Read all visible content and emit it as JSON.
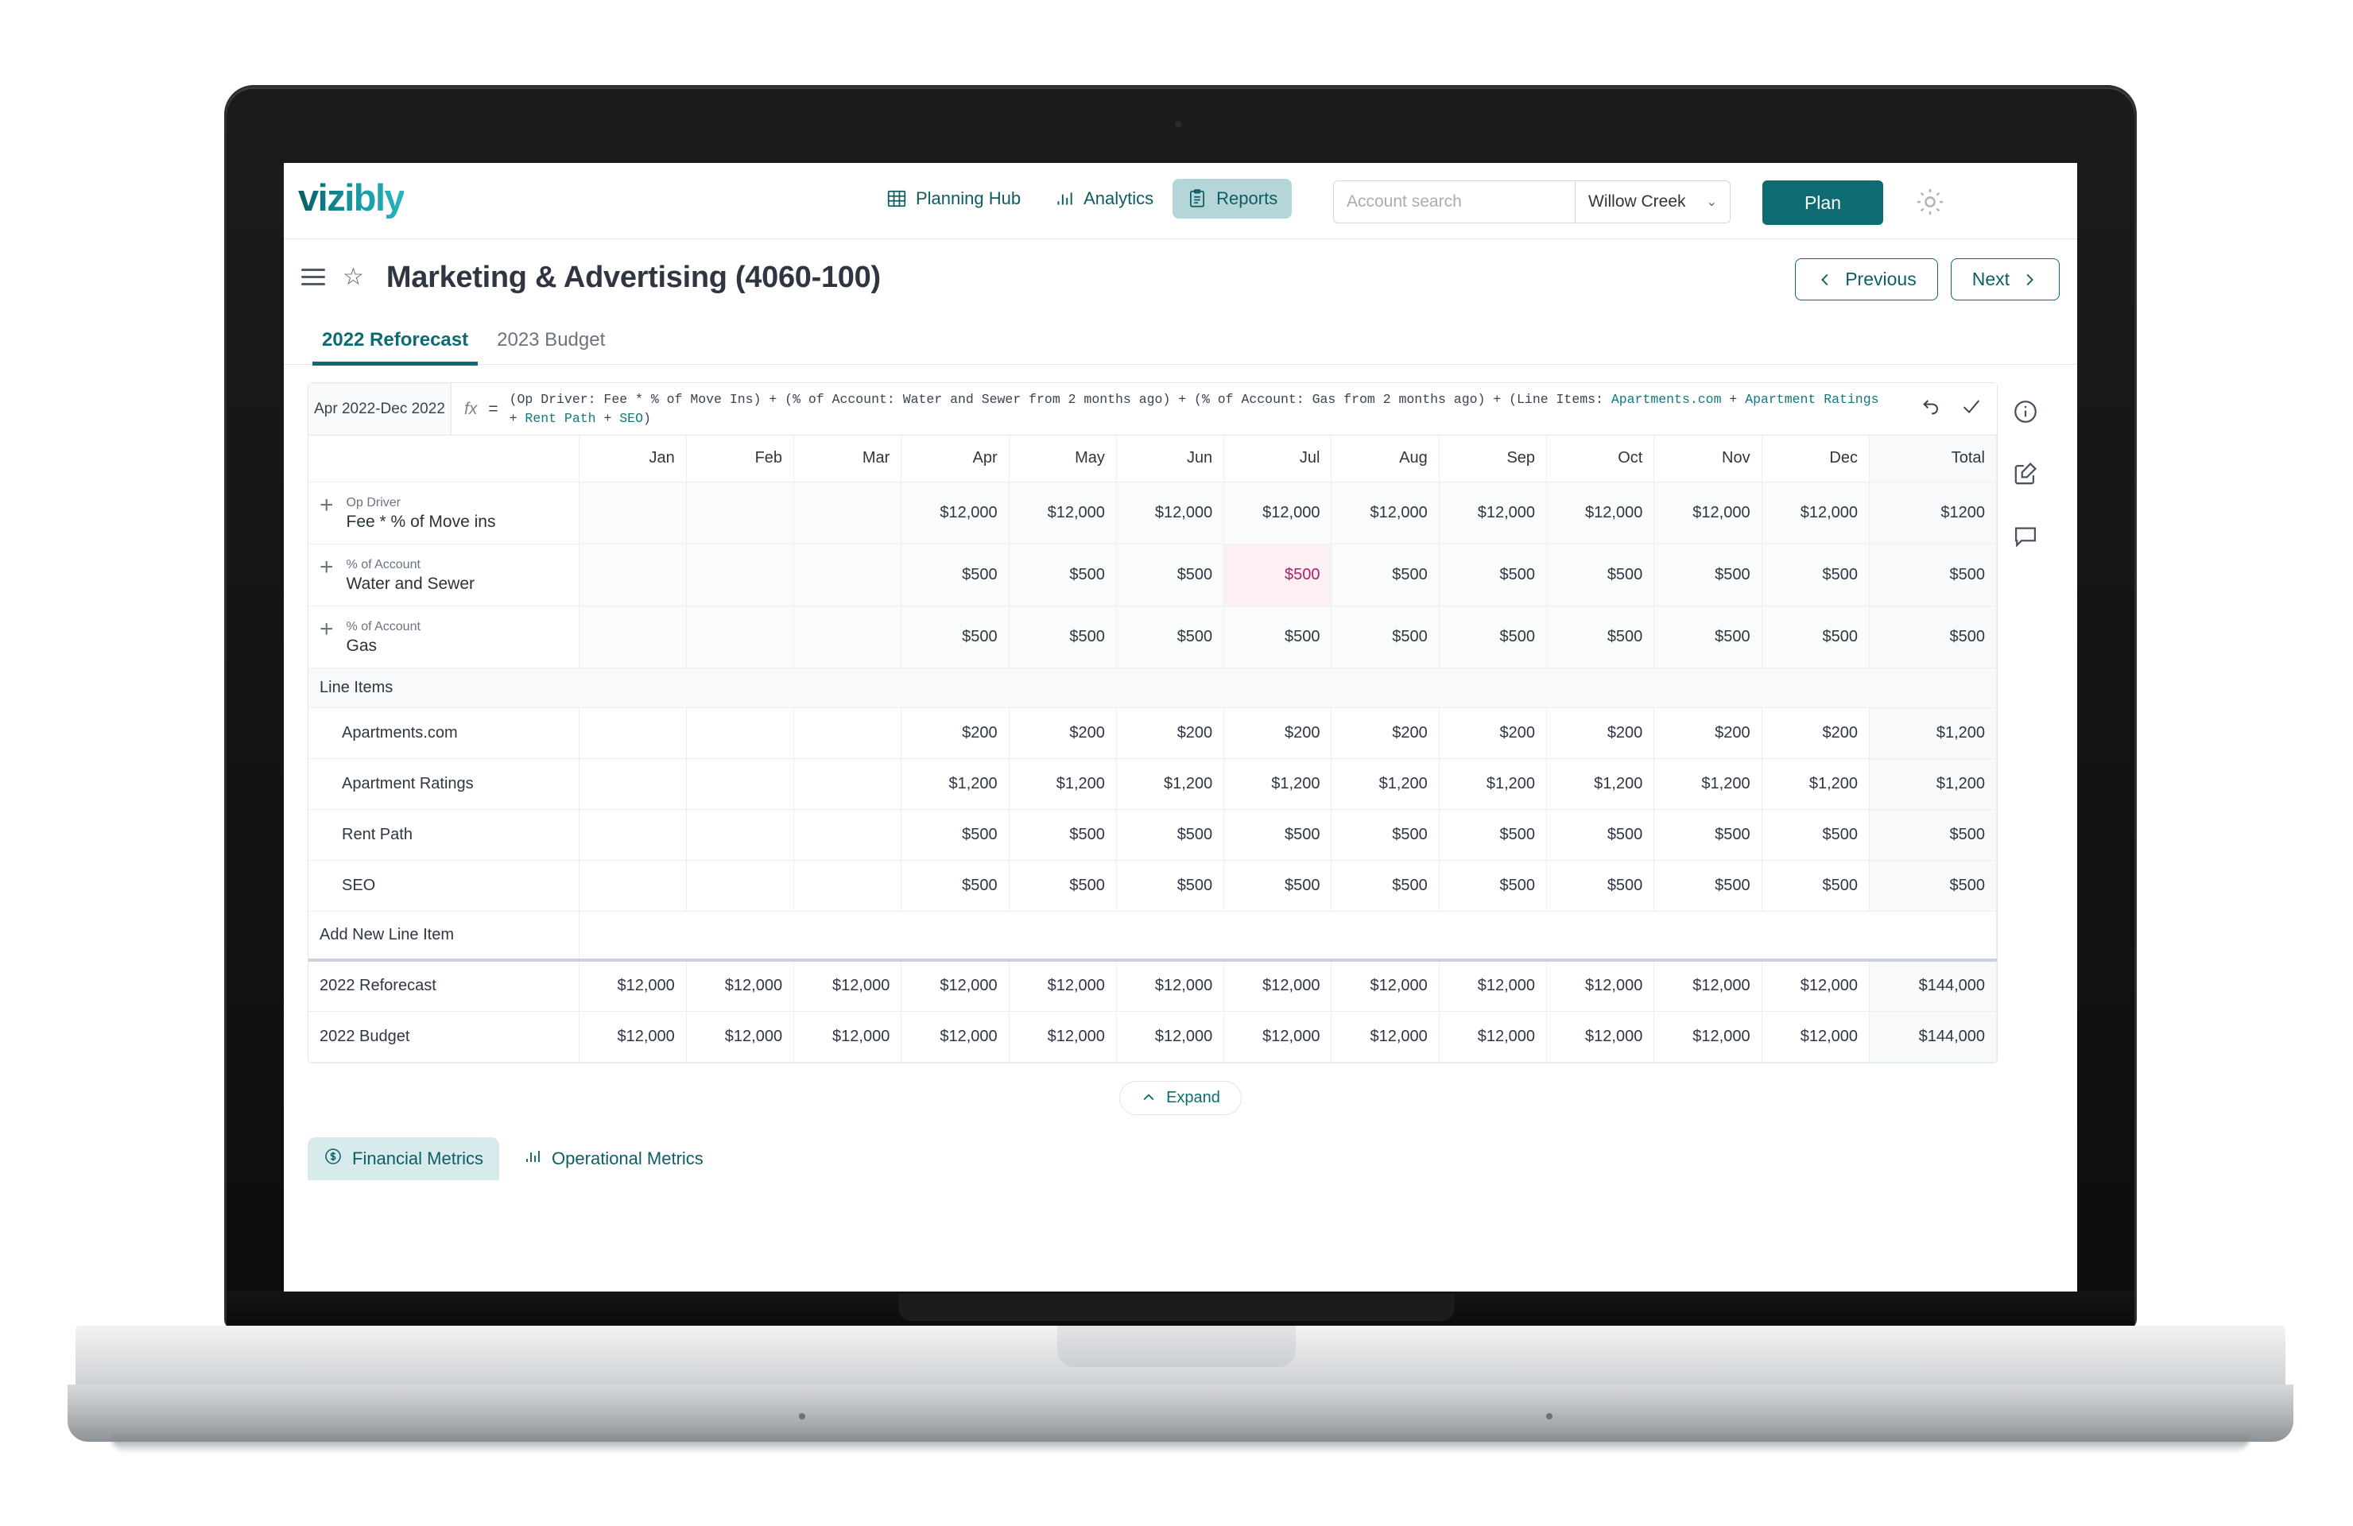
{
  "brand": {
    "name": "vizibly",
    "accent": "#0e6b73"
  },
  "header": {
    "nav": [
      {
        "label": "Planning Hub",
        "icon": "table-grid-icon",
        "active": false
      },
      {
        "label": "Analytics",
        "icon": "bar-chart-icon",
        "active": false
      },
      {
        "label": "Reports",
        "icon": "clipboard-icon",
        "active": true
      }
    ],
    "search": {
      "placeholder": "Account search",
      "value": ""
    },
    "property": {
      "selected": "Willow Creek",
      "caret": "chevron-down-icon"
    },
    "plan_button": "Plan",
    "settings_icon": "gear-icon"
  },
  "title_bar": {
    "menu_icon": "hamburger-icon",
    "favorite_icon": "star-icon",
    "title": "Marketing & Advertising (4060-100)",
    "previous_label": "Previous",
    "next_label": "Next"
  },
  "tabs": [
    {
      "label": "2022 Reforecast",
      "active": true
    },
    {
      "label": "2023 Budget",
      "active": false
    }
  ],
  "formula_bar": {
    "range": "Apr 2022-Dec 2022",
    "fx_label": "fx",
    "equals": "=",
    "formula_plain_1": "(Op Driver: Fee * % of Move Ins) + (% of Account: Water and Sewer from 2 months ago) + (% of Account: Gas from 2 months ago) + (Line Items: ",
    "formula_green_1": "Apartments.com",
    "formula_plain_2": " + ",
    "formula_green_2": "Apartment Ratings",
    "formula_plain_3": " + ",
    "formula_green_3": "Rent Path",
    "formula_plain_4": " + ",
    "formula_green_4": "SEO",
    "formula_plain_5": ")",
    "undo_icon": "undo-arrow-icon",
    "confirm_icon": "checkmark-icon"
  },
  "table": {
    "columns": [
      "",
      "Jan",
      "Feb",
      "Mar",
      "Apr",
      "May",
      "Jun",
      "Jul",
      "Aug",
      "Sep",
      "Oct",
      "Nov",
      "Dec",
      "Total"
    ],
    "driver_rows": [
      {
        "sub": "Op Driver",
        "name": "Fee * % of Move ins",
        "expand_icon": "plus-icon",
        "values": [
          "",
          "",
          "",
          "$12,000",
          "$12,000",
          "$12,000",
          "$12,000",
          "$12,000",
          "$12,000",
          "$12,000",
          "$12,000",
          "$12,000"
        ],
        "total": "$1200",
        "flagged_index": -1
      },
      {
        "sub": "% of Account",
        "name": "Water and Sewer",
        "expand_icon": "plus-icon",
        "values": [
          "",
          "",
          "",
          "$500",
          "$500",
          "$500",
          "$500",
          "$500",
          "$500",
          "$500",
          "$500",
          "$500"
        ],
        "total": "$500",
        "flagged_index": 6
      },
      {
        "sub": "% of Account",
        "name": "Gas",
        "expand_icon": "plus-icon",
        "values": [
          "",
          "",
          "",
          "$500",
          "$500",
          "$500",
          "$500",
          "$500",
          "$500",
          "$500",
          "$500",
          "$500"
        ],
        "total": "$500",
        "flagged_index": -1
      }
    ],
    "section_label": "Line Items",
    "line_rows": [
      {
        "name": "Apartments.com",
        "values": [
          "",
          "",
          "",
          "$200",
          "$200",
          "$200",
          "$200",
          "$200",
          "$200",
          "$200",
          "$200",
          "$200"
        ],
        "total": "$1,200"
      },
      {
        "name": "Apartment Ratings",
        "values": [
          "",
          "",
          "",
          "$1,200",
          "$1,200",
          "$1,200",
          "$1,200",
          "$1,200",
          "$1,200",
          "$1,200",
          "$1,200",
          "$1,200"
        ],
        "total": "$1,200"
      },
      {
        "name": "Rent Path",
        "values": [
          "",
          "",
          "",
          "$500",
          "$500",
          "$500",
          "$500",
          "$500",
          "$500",
          "$500",
          "$500",
          "$500"
        ],
        "total": "$500"
      },
      {
        "name": "SEO",
        "values": [
          "",
          "",
          "",
          "$500",
          "$500",
          "$500",
          "$500",
          "$500",
          "$500",
          "$500",
          "$500",
          "$500"
        ],
        "total": "$500"
      }
    ],
    "add_line_label": "Add New Line Item",
    "total_rows": [
      {
        "name": "2022 Reforecast",
        "values": [
          "$12,000",
          "$12,000",
          "$12,000",
          "$12,000",
          "$12,000",
          "$12,000",
          "$12,000",
          "$12,000",
          "$12,000",
          "$12,000",
          "$12,000",
          "$12,000"
        ],
        "total": "$144,000"
      },
      {
        "name": "2022 Budget",
        "values": [
          "$12,000",
          "$12,000",
          "$12,000",
          "$12,000",
          "$12,000",
          "$12,000",
          "$12,000",
          "$12,000",
          "$12,000",
          "$12,000",
          "$12,000",
          "$12,000"
        ],
        "total": "$144,000"
      }
    ]
  },
  "right_rail": [
    {
      "icon": "info-circle-icon"
    },
    {
      "icon": "edit-note-icon"
    },
    {
      "icon": "comment-bubble-icon"
    }
  ],
  "expand_button": {
    "label": "Expand",
    "icon": "chevron-up-icon"
  },
  "metrics_tabs": [
    {
      "label": "Financial Metrics",
      "icon": "dollar-circle-icon",
      "active": true
    },
    {
      "label": "Operational Metrics",
      "icon": "bar-chart-icon",
      "active": false
    }
  ]
}
